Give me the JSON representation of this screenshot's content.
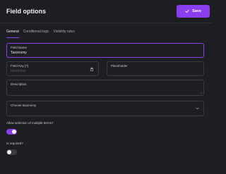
{
  "header": {
    "title": "Field options",
    "save_label": "Save"
  },
  "tabs": [
    {
      "label": "General",
      "active": true
    },
    {
      "label": "Conditional logic",
      "active": false
    },
    {
      "label": "Visibility rules",
      "active": false
    }
  ],
  "form": {
    "field_name": {
      "label": "Field Name",
      "value": "Taxonomy"
    },
    "field_key": {
      "label": "Field Key [?]",
      "value": "taxonomy"
    },
    "placeholder": {
      "label": "Placeholder",
      "value": ""
    },
    "description": {
      "label": "Description",
      "value": ""
    },
    "taxonomy": {
      "label": "Choose taxonomy",
      "value": ""
    },
    "multiple_terms": {
      "label": "Allow selection of multiple terms?",
      "enabled": true
    },
    "required": {
      "label": "Is required?",
      "enabled": false
    }
  },
  "colors": {
    "accent": "#8b3df0",
    "background": "#1d1e22"
  }
}
